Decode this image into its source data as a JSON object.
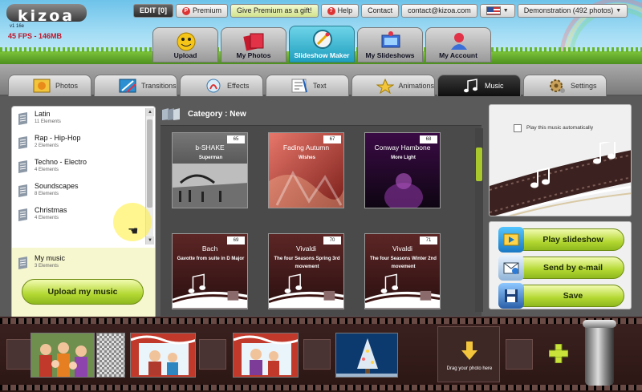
{
  "header": {
    "logo": "kizoa",
    "version": "v1 16e",
    "fps": "45 FPS - 146MB",
    "toplinks": {
      "edit": "EDIT [0]",
      "premium": "Premium",
      "gift": "Give Premium as a gift!",
      "help": "Help",
      "contact": "Contact",
      "email": "contact@kizoa.com",
      "account": "Demonstration (492 photos)"
    },
    "tabs": [
      {
        "label": "Upload",
        "icon": "upload-icon"
      },
      {
        "label": "My Photos",
        "icon": "photos-icon"
      },
      {
        "label": "Slideshow Maker",
        "icon": "slideshow-maker-icon"
      },
      {
        "label": "My Slideshows",
        "icon": "slideshows-icon"
      },
      {
        "label": "My Account",
        "icon": "account-icon"
      }
    ],
    "active_tab": "Slideshow Maker"
  },
  "subtabs": [
    {
      "label": "Photos",
      "icon": "photo-icon"
    },
    {
      "label": "Transitions",
      "icon": "transitions-icon"
    },
    {
      "label": "Effects",
      "icon": "effects-icon"
    },
    {
      "label": "Text",
      "icon": "text-icon"
    },
    {
      "label": "Animations",
      "icon": "animations-icon"
    },
    {
      "label": "Music",
      "icon": "music-note-icon"
    },
    {
      "label": "Settings",
      "icon": "settings-icon"
    }
  ],
  "active_subtab": "Music",
  "categories": [
    {
      "name": "Latin",
      "count": "11 Elements"
    },
    {
      "name": "Rap - Hip-Hop",
      "count": "2 Elements"
    },
    {
      "name": "Techno - Electro",
      "count": "4 Elements"
    },
    {
      "name": "Soundscapes",
      "count": "8 Elements"
    },
    {
      "name": "Christmas",
      "count": "4 Elements"
    }
  ],
  "my_music": {
    "name": "My music",
    "count": "3 Elements"
  },
  "upload_button": "Upload my music",
  "category_title": "Category : New",
  "tracks": [
    {
      "num": "65",
      "title": "b-SHAKE",
      "subtitle": "Superman"
    },
    {
      "num": "67",
      "title": "Fading Autumn",
      "subtitle": "Wishes"
    },
    {
      "num": "68",
      "title": "Conway Hambone",
      "subtitle": "More Light"
    },
    {
      "num": "69",
      "title": "Bach",
      "subtitle": "Gavotte from suite in D Major"
    },
    {
      "num": "70",
      "title": "Vivaldi",
      "subtitle": "The four Seasons Spring 3rd movement"
    },
    {
      "num": "71",
      "title": "Vivaldi",
      "subtitle": "The four Seasons Winter 2nd movement"
    }
  ],
  "autoplay_label": "Play this music automatically",
  "actions": {
    "play": "Play slideshow",
    "email": "Send by e-mail",
    "save": "Save"
  },
  "filmstrip": {
    "drop_text": "Drag your photo here"
  },
  "colors": {
    "accent_green": "#b3d832",
    "active_tab": "#1f9fbf",
    "music_card": "#5c2625"
  }
}
